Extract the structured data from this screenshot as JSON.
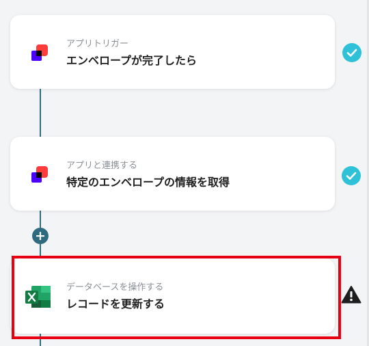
{
  "steps": [
    {
      "subtitle": "アプリトリガー",
      "title": "エンベロープが完了したら",
      "app_icon": "docusign-icon",
      "status_icon": "check-icon",
      "status_color": "#2fc1d8"
    },
    {
      "subtitle": "アプリと連携する",
      "title": "特定のエンベロープの情報を取得",
      "app_icon": "docusign-icon",
      "status_icon": "check-icon",
      "status_color": "#2fc1d8"
    },
    {
      "subtitle": "データベースを操作する",
      "title": "レコードを更新する",
      "app_icon": "excel-icon",
      "status_icon": "warning-icon",
      "status_color": "#1e1e1e",
      "highlighted": true
    }
  ],
  "add_step": {
    "label": "+",
    "icon": "plus-icon"
  },
  "colors": {
    "connector": "#2e6a80",
    "highlight": "#e60012",
    "docusign_red": "#ff3c3c",
    "docusign_purple": "#4c00ff",
    "excel_green": "#107c41"
  }
}
